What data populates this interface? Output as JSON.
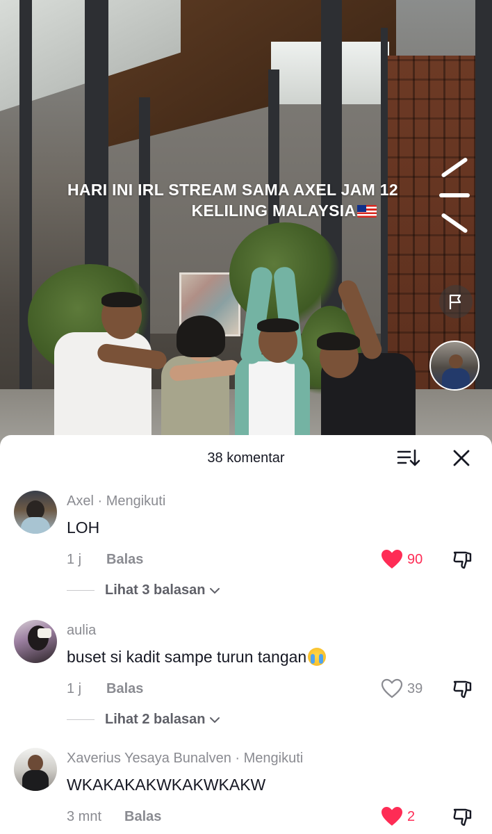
{
  "video": {
    "caption_line1": "HARI INI IRL STREAM SAMA AXEL JAM 12",
    "caption_line2": "KELILING MALAYSIA"
  },
  "comments_sheet": {
    "title": "38 komentar",
    "sort_icon": "sort-icon",
    "close_icon": "close-icon"
  },
  "comments": [
    {
      "author": "Axel",
      "separator": "·",
      "follow_status": "Mengikuti",
      "text": "LOH",
      "time": "1 j",
      "reply_label": "Balas",
      "likes": "90",
      "liked": true,
      "view_replies": "Lihat 3 balasan"
    },
    {
      "author": "aulia",
      "text": "buset si kadit sampe turun tangan",
      "emoji": "loudly-crying-face",
      "time": "1 j",
      "reply_label": "Balas",
      "likes": "39",
      "liked": false,
      "view_replies": "Lihat 2 balasan"
    },
    {
      "author": "Xaverius Yesaya Bunalven",
      "separator": "·",
      "follow_status": "Mengikuti",
      "text": "WKAKAKAKWKAKWKAKW",
      "time": "3 mnt",
      "reply_label": "Balas",
      "likes": "2",
      "liked": true
    }
  ],
  "colors": {
    "like_active": "#fe2c55",
    "text_primary": "#161823",
    "text_secondary": "#8a8b91"
  }
}
